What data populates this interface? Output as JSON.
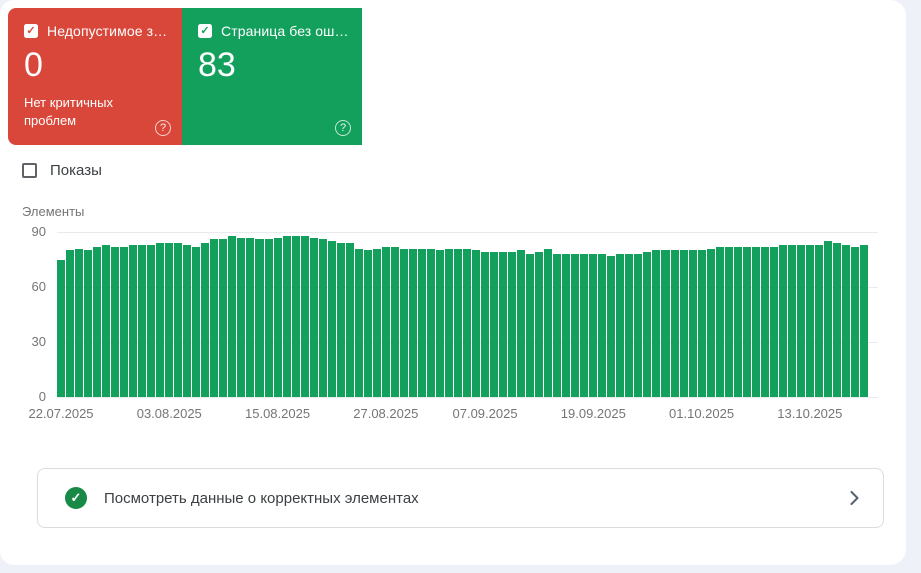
{
  "colors": {
    "error": "#D9473A",
    "valid": "#12A05C",
    "footer_icon": "#188947"
  },
  "cards": {
    "error": {
      "label": "Недопустимое з…",
      "value": "0",
      "subtext": "Нет критичных проблем",
      "checked": true,
      "help_icon": "?"
    },
    "valid": {
      "label": "Страница без ош…",
      "value": "83",
      "checked": true,
      "help_icon": "?"
    }
  },
  "impressions": {
    "label": "Показы",
    "checked": false
  },
  "chart_data": {
    "type": "bar",
    "title": "",
    "xlabel": "",
    "ylabel": "Элементы",
    "ylim": [
      0,
      90
    ],
    "yticks": [
      0,
      30,
      60,
      90
    ],
    "grid": true,
    "legend": "none",
    "x_tick_labels": [
      "22.07.2025",
      "03.08.2025",
      "15.08.2025",
      "27.08.2025",
      "07.09.2025",
      "19.09.2025",
      "01.10.2025",
      "13.10.2025"
    ],
    "x_tick_bar_indices": [
      0,
      12,
      24,
      36,
      47,
      59,
      71,
      83
    ],
    "series": [
      {
        "name": "Страница без ошибок",
        "values": [
          75,
          80,
          81,
          80,
          82,
          83,
          82,
          82,
          83,
          83,
          83,
          84,
          84,
          84,
          83,
          82,
          84,
          86,
          86,
          88,
          87,
          87,
          86,
          86,
          87,
          88,
          88,
          88,
          87,
          86,
          85,
          84,
          84,
          81,
          80,
          81,
          82,
          82,
          81,
          81,
          81,
          81,
          80,
          81,
          81,
          81,
          80,
          79,
          79,
          79,
          79,
          80,
          78,
          79,
          81,
          78,
          78,
          78,
          78,
          78,
          78,
          77,
          78,
          78,
          78,
          79,
          80,
          80,
          80,
          80,
          80,
          80,
          81,
          82,
          82,
          82,
          82,
          82,
          82,
          82,
          83,
          83,
          83,
          83,
          83,
          85,
          84,
          83,
          82,
          83
        ]
      }
    ]
  },
  "footer": {
    "label": "Посмотреть данные о корректных элементах"
  }
}
